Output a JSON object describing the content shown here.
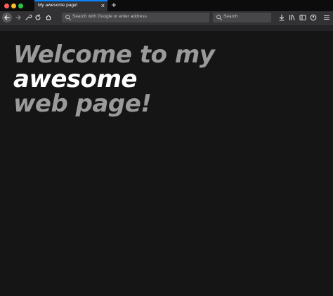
{
  "tab": {
    "title": "My awesome page!",
    "close_glyph": "×",
    "new_tab_glyph": "+"
  },
  "toolbar": {
    "back_icon": "back-arrow-icon",
    "forward_icon": "forward-arrow-icon",
    "tools_icon": "wrench-icon",
    "reload_icon": "reload-icon",
    "home_icon": "home-icon"
  },
  "urlbar": {
    "placeholder": "Search with Google or enter address"
  },
  "searchbar": {
    "placeholder": "Search"
  },
  "page": {
    "headline_pre": "Welcome to my ",
    "headline_em": "awesome",
    "headline_post": "web page!"
  },
  "colors": {
    "background": "#151515",
    "toolbar": "#323234",
    "tab_accent": "#0a84ff",
    "headline_gray": "#9a9a9a",
    "headline_white": "#ffffff"
  }
}
